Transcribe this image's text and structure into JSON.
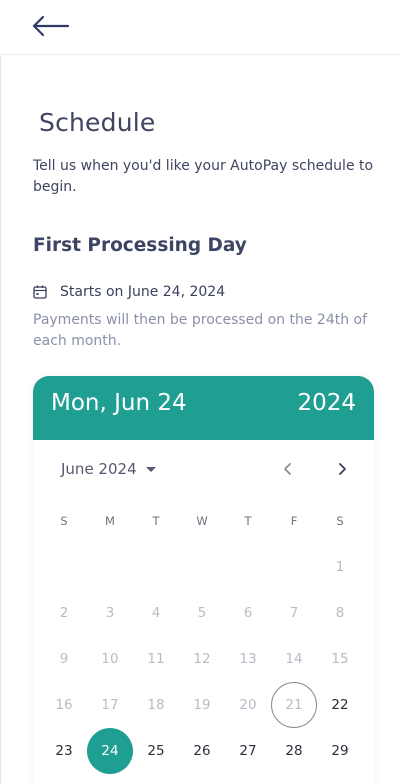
{
  "screen": {
    "title": "Schedule",
    "intro": "Tell us when you'd like your AutoPay schedule to begin.",
    "section_title": "First Processing Day",
    "starts_on": "Starts on June 24, 2024",
    "note": "Payments will then be processed on the 24th of each month."
  },
  "calendar": {
    "header_date": "Mon, Jun 24",
    "header_year": "2024",
    "month_label": "June 2024",
    "accent_color": "#1f9e92",
    "weekdays": [
      "S",
      "M",
      "T",
      "W",
      "T",
      "F",
      "S"
    ],
    "rows": [
      [
        null,
        null,
        null,
        null,
        null,
        null,
        "1"
      ],
      [
        "2",
        "3",
        "4",
        "5",
        "6",
        "7",
        "8"
      ],
      [
        "9",
        "10",
        "11",
        "12",
        "13",
        "14",
        "15"
      ],
      [
        "16",
        "17",
        "18",
        "19",
        "20",
        "21",
        "22"
      ],
      [
        "23",
        "24",
        "25",
        "26",
        "27",
        "28",
        "29"
      ]
    ],
    "today": "21",
    "selected": "24",
    "first_enabled": 22
  },
  "icons": {
    "back": "arrow-left-icon",
    "calendar": "calendar-icon",
    "prev": "chevron-left-icon",
    "next": "chevron-right-icon",
    "dropdown": "caret-down-icon"
  }
}
